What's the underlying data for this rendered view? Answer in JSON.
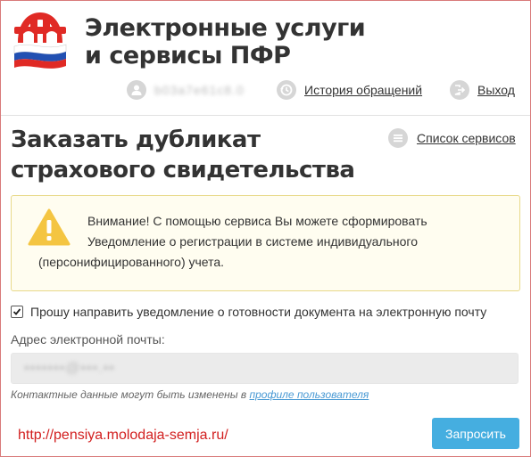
{
  "header": {
    "title_line1": "Электронные услуги",
    "title_line2": "и сервисы ПФР",
    "user_name": "b03a7e61c8.0",
    "history_label": "История обращений",
    "logout_label": "Выход"
  },
  "page": {
    "title_line1": "Заказать дубликат",
    "title_line2": "страхового свидетельства",
    "services_link": "Список сервисов"
  },
  "warning": {
    "line1": "Внимание! С помощью сервиса Вы можете сформировать",
    "line2": "Уведомление о регистрации в системе индивидуального",
    "line3": "(персонифицированного) учета."
  },
  "form": {
    "checkbox_label": "Прошу направить уведомление о готовности документа на электронную почту",
    "checkbox_checked": true,
    "email_label": "Адрес электронной почты:",
    "email_value": "•••••••@•••.••",
    "hint_prefix": "Контактные данные могут быть изменены в",
    "hint_link": "профиле пользователя",
    "submit_label": "Запросить"
  },
  "watermark": "http://pensiya.molodaja-semja.ru/",
  "colors": {
    "accent_button": "#45aee0",
    "link_blue": "#4a9ad4",
    "warning_icon": "#f4c542",
    "watermark_red": "#d21f1f",
    "logo_red": "#e02a25",
    "flag_blue": "#2250b2"
  }
}
